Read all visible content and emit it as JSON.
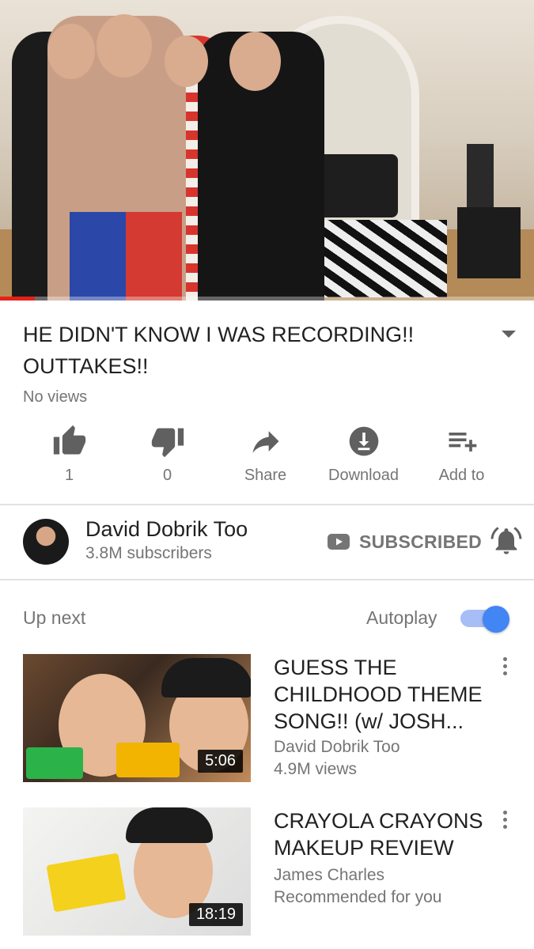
{
  "player": {
    "progress_fraction": 0.065,
    "colors": {
      "progress": "#e62117"
    }
  },
  "video": {
    "title": "HE DIDN'T KNOW I WAS RECORDING!! OUTTAKES!!",
    "views": "No views"
  },
  "actions": [
    {
      "icon": "thumbs-up-icon",
      "label": "1"
    },
    {
      "icon": "thumbs-down-icon",
      "label": "0"
    },
    {
      "icon": "share-icon",
      "label": "Share"
    },
    {
      "icon": "download-icon",
      "label": "Download"
    },
    {
      "icon": "playlist-add-icon",
      "label": "Add to"
    }
  ],
  "channel": {
    "name": "David Dobrik Too",
    "subscribers": "3.8M subscribers",
    "subscribe_label": "SUBSCRIBED",
    "bell_icon": "bell-ring-icon"
  },
  "up_next": {
    "heading": "Up next",
    "autoplay_label": "Autoplay",
    "autoplay_on": true,
    "accent": "#4285f4"
  },
  "videos": [
    {
      "title": "GUESS THE CHILDHOOD THEME SONG!! (w/ JOSH...",
      "channel": "David Dobrik Too",
      "meta": "4.9M views",
      "duration": "5:06"
    },
    {
      "title": "CRAYOLA CRAYONS MAKEUP REVIEW",
      "channel": "James Charles",
      "meta": "Recommended for you",
      "duration": "18:19"
    }
  ]
}
